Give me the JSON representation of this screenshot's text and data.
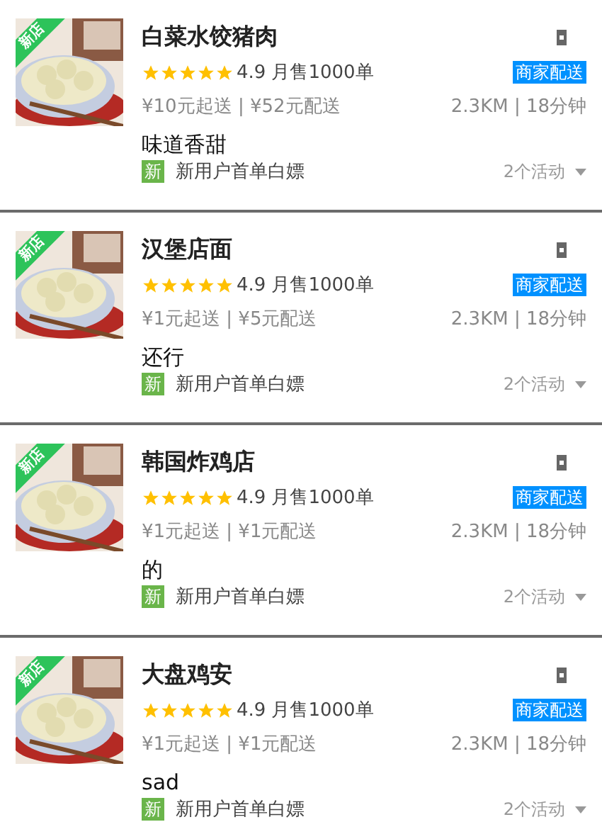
{
  "shops": [
    {
      "badge": "新店",
      "name": "白菜水饺猪肉",
      "stars": 5,
      "rating": "4.9",
      "sales": "月售1000单",
      "delivery_tag": "商家配送",
      "prices": "¥10元起送 | ¥52元配送",
      "distance": "2.3KM | 18分钟",
      "description": "味道香甜",
      "promo_tag": "新",
      "promo": "新用户首单白嫖",
      "activities": "2个活动"
    },
    {
      "badge": "新店",
      "name": "汉堡店面",
      "stars": 5,
      "rating": "4.9",
      "sales": "月售1000单",
      "delivery_tag": "商家配送",
      "prices": "¥1元起送 | ¥5元配送",
      "distance": "2.3KM | 18分钟",
      "description": "还行",
      "promo_tag": "新",
      "promo": "新用户首单白嫖",
      "activities": "2个活动"
    },
    {
      "badge": "新店",
      "name": "韩国炸鸡店",
      "stars": 5,
      "rating": "4.9",
      "sales": "月售1000单",
      "delivery_tag": "商家配送",
      "prices": "¥1元起送 | ¥1元配送",
      "distance": "2.3KM | 18分钟",
      "description": "的",
      "promo_tag": "新",
      "promo": "新用户首单白嫖",
      "activities": "2个活动"
    },
    {
      "badge": "新店",
      "name": "大盘鸡安",
      "stars": 5,
      "rating": "4.9",
      "sales": "月售1000单",
      "delivery_tag": "商家配送",
      "prices": "¥1元起送 | ¥1元配送",
      "distance": "2.3KM | 18分钟",
      "description": "sad",
      "promo_tag": "新",
      "promo": "新用户首单白嫖",
      "activities": "2个活动"
    }
  ]
}
